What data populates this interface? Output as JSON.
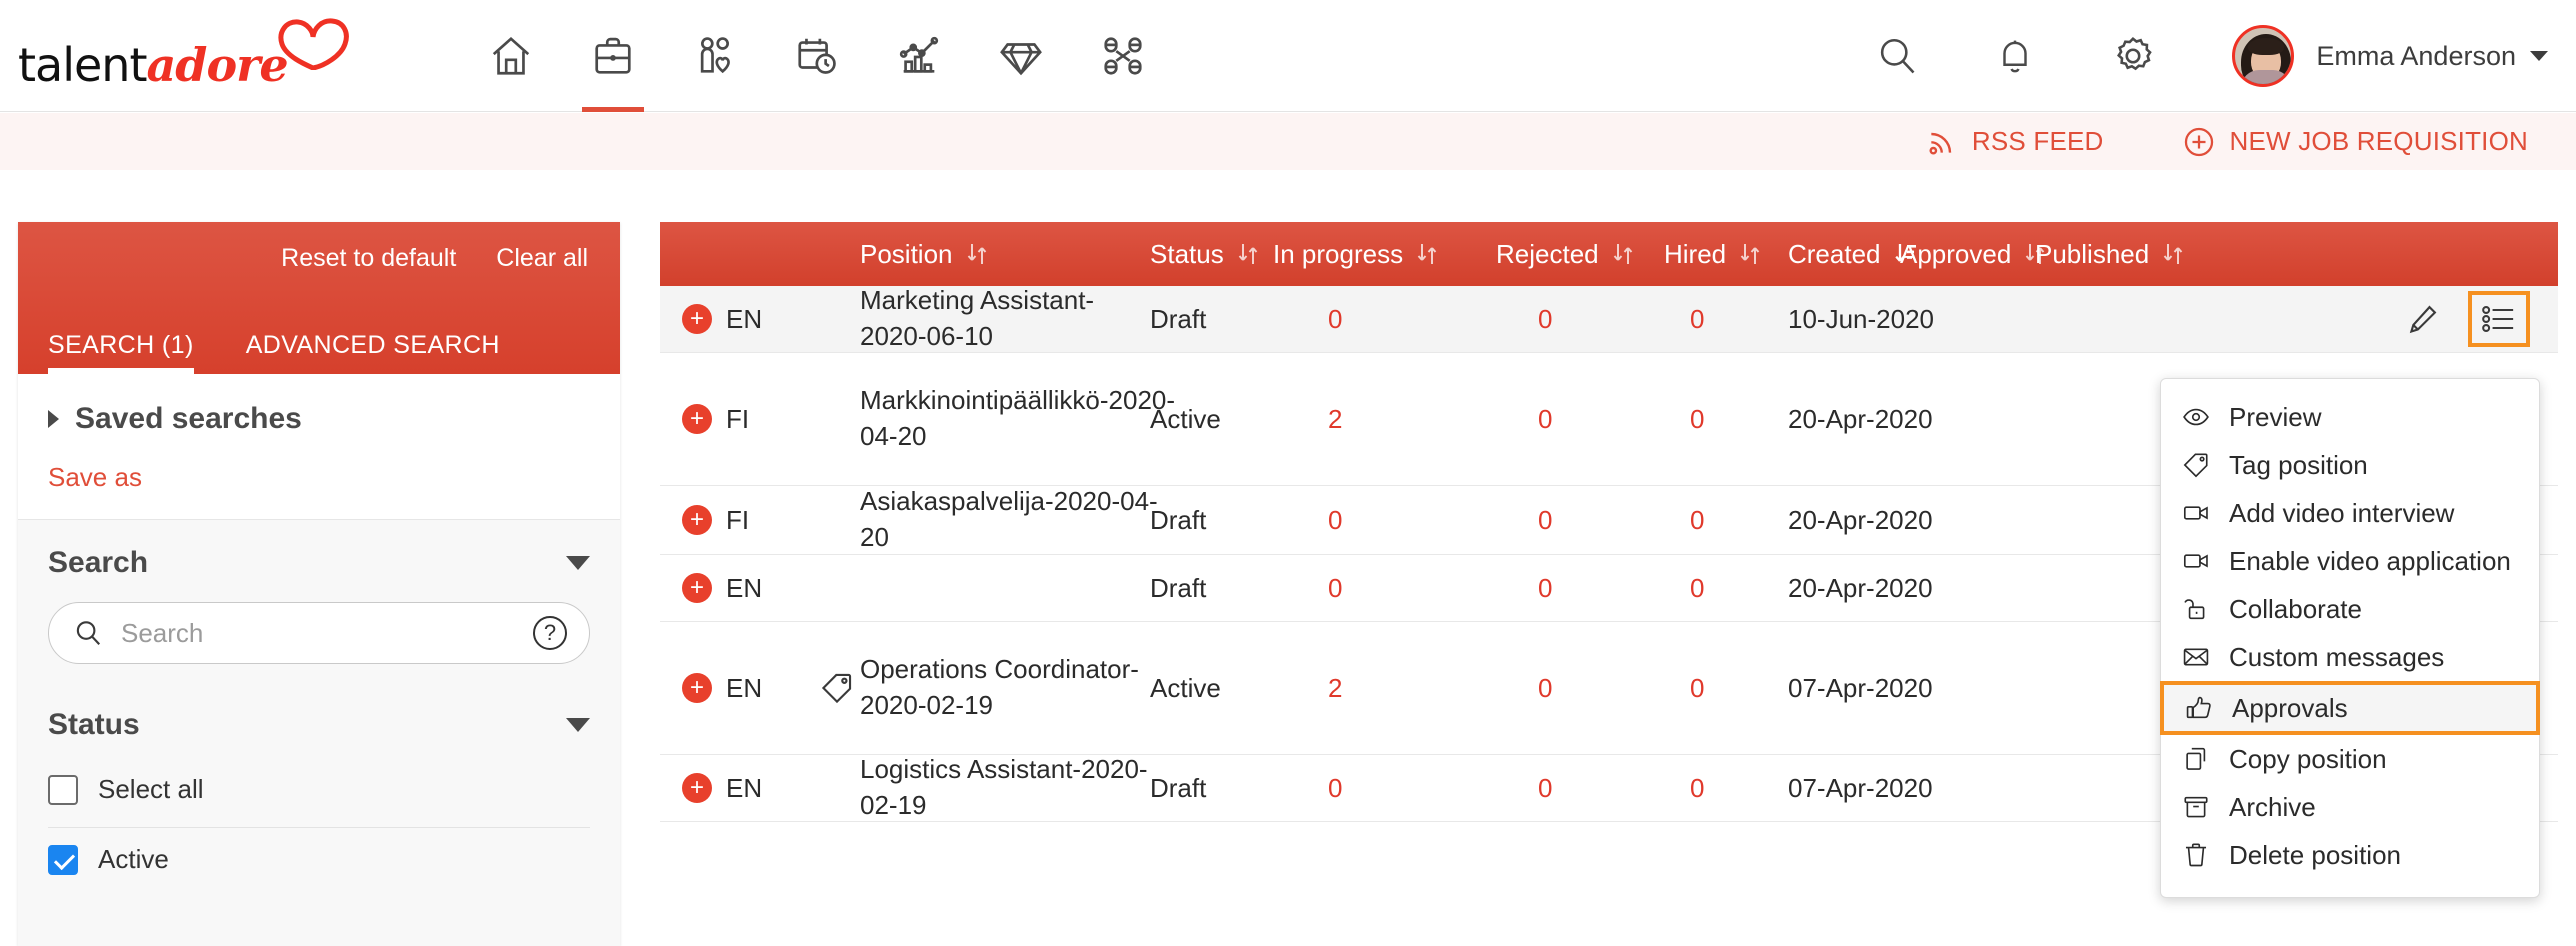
{
  "brand": {
    "name_part1": "talent",
    "name_part2": "adore"
  },
  "topnav": {
    "items": [
      {
        "name": "home",
        "label": "Home"
      },
      {
        "name": "jobs",
        "label": "Jobs",
        "active": true
      },
      {
        "name": "candidates",
        "label": "Candidates"
      },
      {
        "name": "calendar",
        "label": "Calendar"
      },
      {
        "name": "analytics",
        "label": "Analytics"
      },
      {
        "name": "talent-pool",
        "label": "Talent pool"
      },
      {
        "name": "network",
        "label": "Network"
      }
    ],
    "search_icon": "search-icon",
    "bell_icon": "bell-icon",
    "gear_icon": "gear-icon",
    "user_name": "Emma Anderson"
  },
  "actionbar": {
    "rss_label": "RSS FEED",
    "new_requisition_label": "NEW JOB REQUISITION"
  },
  "sidebar": {
    "reset_label": "Reset to default",
    "clear_label": "Clear all",
    "tabs": [
      {
        "label": "SEARCH (1)",
        "active": true
      },
      {
        "label": "ADVANCED SEARCH",
        "active": false
      }
    ],
    "saved_searches_label": "Saved searches",
    "save_as_label": "Save as",
    "search_section": {
      "title": "Search",
      "input_value": "",
      "placeholder": "Search",
      "help_glyph": "?"
    },
    "status_section": {
      "title": "Status",
      "select_all_label": "Select all",
      "options": [
        {
          "label": "Active",
          "checked": true
        }
      ]
    }
  },
  "table": {
    "columns": [
      {
        "key": "position",
        "label": "Position",
        "sorted": false
      },
      {
        "key": "status",
        "label": "Status",
        "sorted": false
      },
      {
        "key": "inprogress",
        "label": "In progress",
        "sorted": false
      },
      {
        "key": "rejected",
        "label": "Rejected",
        "sorted": false
      },
      {
        "key": "hired",
        "label": "Hired",
        "sorted": false
      },
      {
        "key": "created",
        "label": "Created",
        "sorted": true,
        "direction": "desc"
      },
      {
        "key": "approved",
        "label": "Approved",
        "sorted": false
      },
      {
        "key": "published",
        "label": "Published",
        "sorted": false
      }
    ],
    "rows": [
      {
        "lang": "EN",
        "tag": false,
        "position": "Marketing Assistant-2020-06-10",
        "status": "Draft",
        "in_progress": "0",
        "rejected": "0",
        "hired": "0",
        "created": "10-Jun-2020",
        "approved": "",
        "published": ""
      },
      {
        "lang": "FI",
        "tag": false,
        "position": "Markkinointipäällikkö-2020-04-20",
        "status": "Active",
        "in_progress": "2",
        "rejected": "0",
        "hired": "0",
        "created": "20-Apr-2020",
        "approved": "",
        "published": ""
      },
      {
        "lang": "FI",
        "tag": false,
        "position": "Asiakaspalvelija-2020-04-20",
        "status": "Draft",
        "in_progress": "0",
        "rejected": "0",
        "hired": "0",
        "created": "20-Apr-2020",
        "approved": "",
        "published": ""
      },
      {
        "lang": "EN",
        "tag": false,
        "position": "",
        "status": "Draft",
        "in_progress": "0",
        "rejected": "0",
        "hired": "0",
        "created": "20-Apr-2020",
        "approved": "",
        "published": ""
      },
      {
        "lang": "EN",
        "tag": true,
        "position": "Operations Coordinator-2020-02-19",
        "status": "Active",
        "in_progress": "2",
        "rejected": "0",
        "hired": "0",
        "created": "07-Apr-2020",
        "approved": "",
        "published": ""
      },
      {
        "lang": "EN",
        "tag": false,
        "position": "Logistics Assistant-2020-02-19",
        "status": "Draft",
        "in_progress": "0",
        "rejected": "0",
        "hired": "0",
        "created": "07-Apr-2020",
        "approved": "",
        "published": ""
      }
    ],
    "row_actions": {
      "edit": "edit-pencil",
      "menu": "list-menu"
    }
  },
  "context_menu": {
    "items": [
      {
        "icon": "eye-icon",
        "label": "Preview",
        "selected": false
      },
      {
        "icon": "tag-icon",
        "label": "Tag position",
        "selected": false
      },
      {
        "icon": "video-icon",
        "label": "Add video interview",
        "selected": false
      },
      {
        "icon": "video-icon",
        "label": "Enable video application",
        "selected": false
      },
      {
        "icon": "unlock-icon",
        "label": "Collaborate",
        "selected": false
      },
      {
        "icon": "envelope-icon",
        "label": "Custom messages",
        "selected": false
      },
      {
        "icon": "thumbs-up-icon",
        "label": "Approvals",
        "selected": true
      },
      {
        "icon": "copy-icon",
        "label": "Copy position",
        "selected": false
      },
      {
        "icon": "archive-icon",
        "label": "Archive",
        "selected": false
      },
      {
        "icon": "trash-icon",
        "label": "Delete position",
        "selected": false
      }
    ]
  },
  "colors": {
    "brand_red": "#e04e39",
    "header_red": "#d6402c",
    "highlight_orange": "#f59020",
    "link_red": "#e0392b",
    "checkbox_blue": "#1a85f0"
  }
}
